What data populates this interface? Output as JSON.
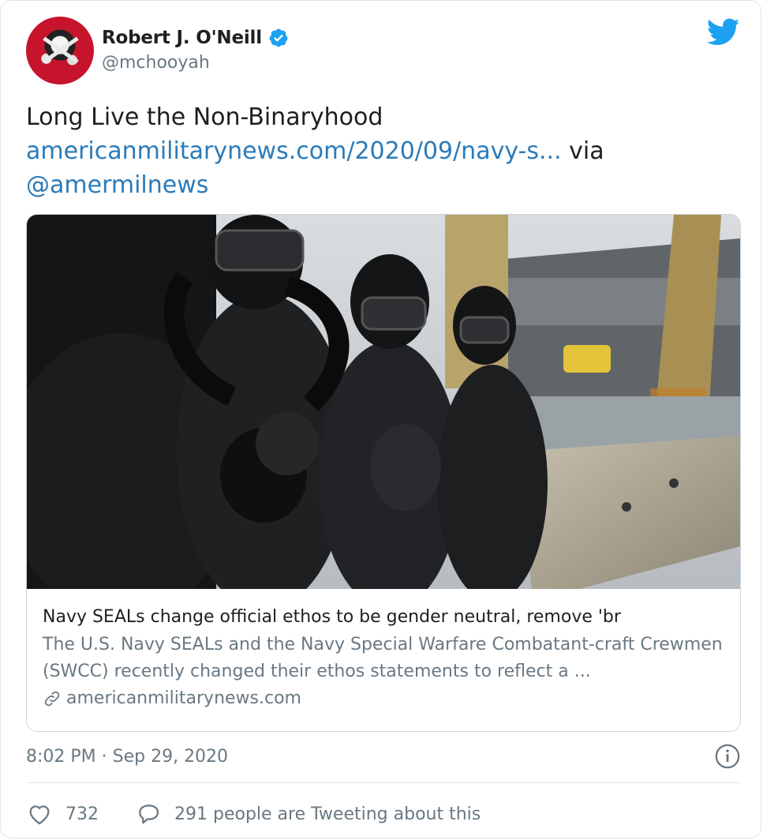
{
  "user": {
    "display_name": "Robert J. O'Neill",
    "handle": "@mchooyah",
    "verified": true,
    "avatar_icon": "avatar-image"
  },
  "tweet": {
    "text": "Long Live the Non-Binaryhood",
    "link_text": "americanmilitarynews.com/2020/09/navy-s...",
    "via_text": "via",
    "mention": "@amermilnews"
  },
  "card": {
    "image_alt": "Navy divers in black wetsuits and rebreathers seated on a boat edge near a pier",
    "title": "Navy SEALs change official ethos to be gender neutral, remove 'br",
    "description": "The U.S. Navy SEALs and the Navy Special Warfare Combatant-craft Crewmen (SWCC) recently changed their ethos statements to reflect a ...",
    "domain": "americanmilitarynews.com",
    "domain_icon": "link-icon"
  },
  "meta": {
    "timestamp": "8:02 PM · Sep 29, 2020",
    "info_icon": "info-icon"
  },
  "actions": {
    "like_count": "732",
    "reply_text": "291 people are Tweeting about this",
    "like_icon": "heart-icon",
    "reply_icon": "speech-bubble-icon"
  },
  "colors": {
    "link": "#2b7bb9",
    "twitter_blue": "#1da1f2",
    "secondary_text": "#697882",
    "border": "#ccd6dd"
  }
}
